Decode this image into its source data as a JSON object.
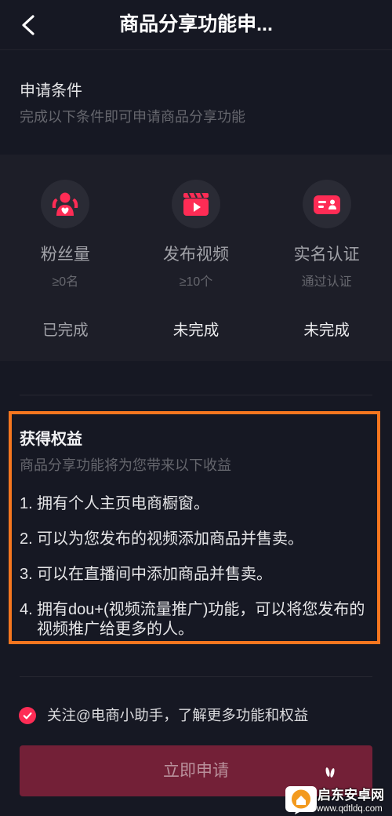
{
  "colors": {
    "background": "#161823",
    "accent": "#fe2c55",
    "highlight_border": "#f5761f"
  },
  "header": {
    "back_icon": "chevron-left-icon",
    "title": "商品分享功能申..."
  },
  "conditions": {
    "title": "申请条件",
    "subtitle": "完成以下条件即可申请商品分享功能",
    "items": [
      {
        "icon": "fans-icon",
        "label": "粉丝量",
        "requirement": "≥0名",
        "status": "已完成",
        "completed": true
      },
      {
        "icon": "video-publish-icon",
        "label": "发布视频",
        "requirement": "≥10个",
        "status": "未完成",
        "completed": false
      },
      {
        "icon": "id-card-icon",
        "label": "实名认证",
        "requirement": "通过认证",
        "status": "未完成",
        "completed": false
      }
    ]
  },
  "benefits": {
    "title": "获得权益",
    "subtitle": "商品分享功能将为您带来以下收益",
    "items": [
      {
        "number": "1.",
        "text": "拥有个人主页电商橱窗。"
      },
      {
        "number": "2.",
        "text": "可以为您发布的视频添加商品并售卖。"
      },
      {
        "number": "3.",
        "text": "可以在直播间中添加商品并售卖。"
      },
      {
        "number": "4.",
        "text": "拥有dou+(视频流量推广)功能，可以将您发布的视频推广给更多的人。"
      }
    ]
  },
  "follow": {
    "checked": true,
    "check_icon": "checkmark-icon",
    "label": "关注@电商小助手，了解更多功能和权益"
  },
  "apply_button": {
    "label": "立即申请",
    "enabled": false
  },
  "watermark": {
    "site_name": "启东安卓网",
    "url": "www.qdtldq.com"
  }
}
